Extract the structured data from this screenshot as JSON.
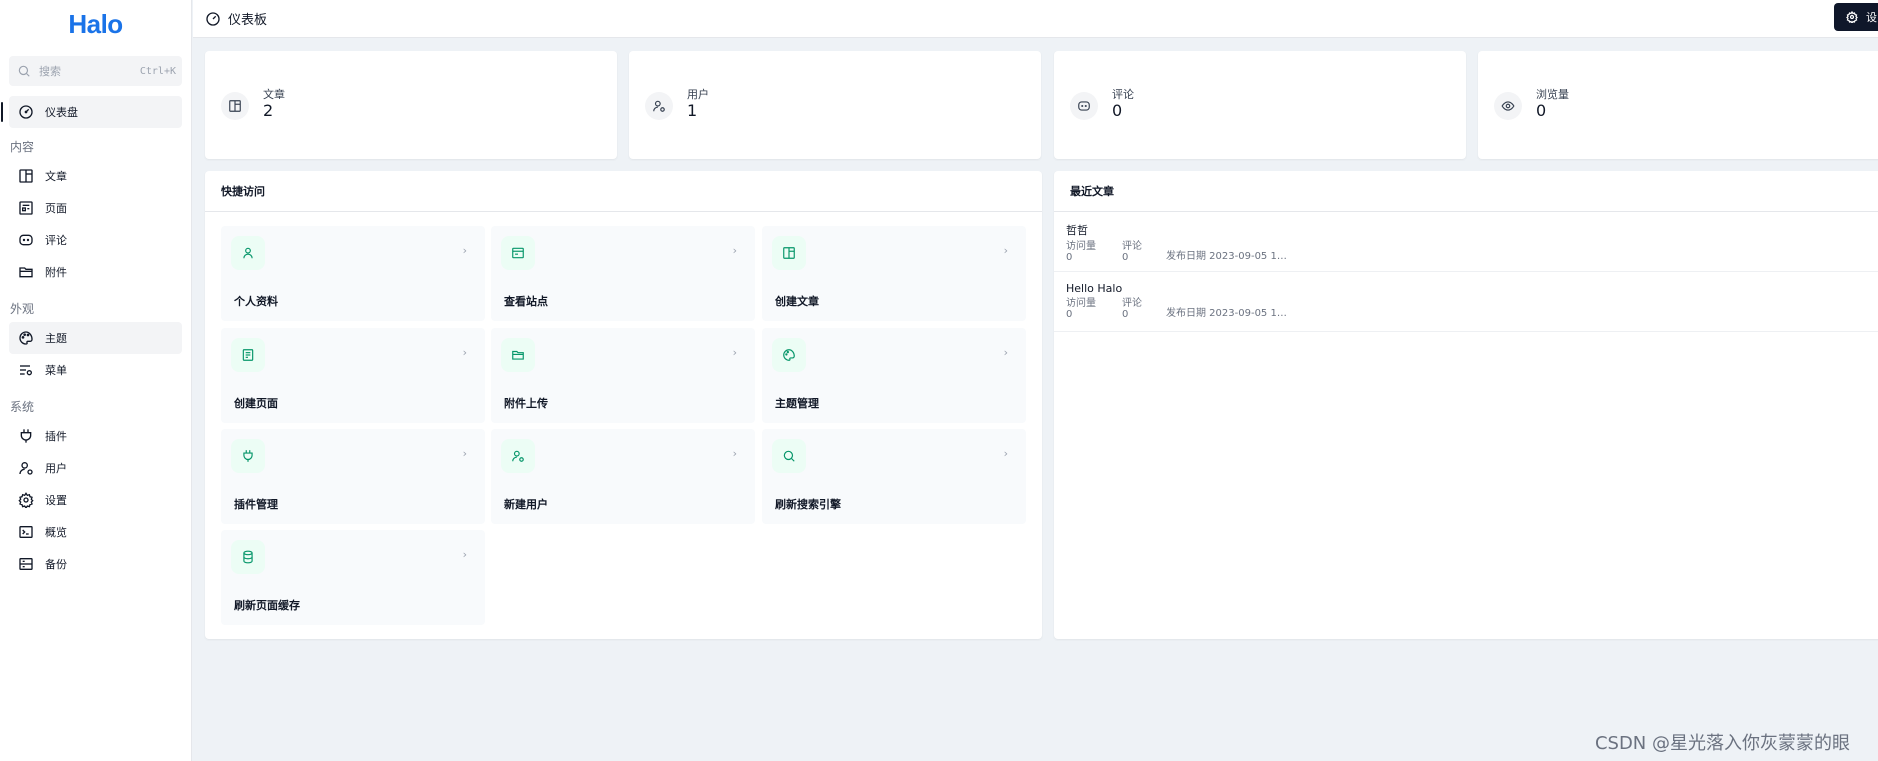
{
  "app": {
    "logo_text": "Halo",
    "brand_color": "#1a73e8"
  },
  "search": {
    "placeholder": "搜索",
    "shortcut": "Ctrl+K"
  },
  "sidebar": {
    "dashboard_label": "仪表盘",
    "groups": [
      {
        "title": "内容",
        "items": [
          "文章",
          "页面",
          "评论",
          "附件"
        ]
      },
      {
        "title": "外观",
        "items": [
          "主题",
          "菜单"
        ]
      },
      {
        "title": "系统",
        "items": [
          "插件",
          "用户",
          "设置",
          "概览",
          "备份"
        ]
      }
    ]
  },
  "header": {
    "title": "仪表板",
    "button_label": "设"
  },
  "stats": [
    {
      "label": "文章",
      "value": "2",
      "icon": "article-icon"
    },
    {
      "label": "用户",
      "value": "1",
      "icon": "user-icon"
    },
    {
      "label": "评论",
      "value": "0",
      "icon": "comment-icon"
    },
    {
      "label": "浏览量",
      "value": "0",
      "icon": "eye-icon"
    }
  ],
  "quick_access": {
    "title": "快捷访问",
    "items": [
      {
        "label": "个人资料",
        "icon": "user-icon"
      },
      {
        "label": "查看站点",
        "icon": "browser-icon"
      },
      {
        "label": "创建文章",
        "icon": "article-icon"
      },
      {
        "label": "创建页面",
        "icon": "page-icon"
      },
      {
        "label": "附件上传",
        "icon": "folder-icon"
      },
      {
        "label": "主题管理",
        "icon": "palette-icon"
      },
      {
        "label": "插件管理",
        "icon": "plug-icon"
      },
      {
        "label": "新建用户",
        "icon": "user-add-icon"
      },
      {
        "label": "刷新搜索引擎",
        "icon": "search-icon"
      },
      {
        "label": "刷新页面缓存",
        "icon": "database-icon"
      }
    ],
    "accent_color": "#10b981"
  },
  "recent_posts": {
    "title": "最近文章",
    "posts": [
      {
        "title": "哲哲",
        "views_label": "访问量",
        "views": "0",
        "comments_label": "评论",
        "comments": "0",
        "date": "发布日期 2023-09-05 1…"
      },
      {
        "title": "Hello Halo",
        "views_label": "访问量",
        "views": "0",
        "comments_label": "评论",
        "comments": "0",
        "date": "发布日期 2023-09-05 1…"
      }
    ]
  },
  "watermark": "CSDN @星光落入你灰蒙蒙的眼"
}
